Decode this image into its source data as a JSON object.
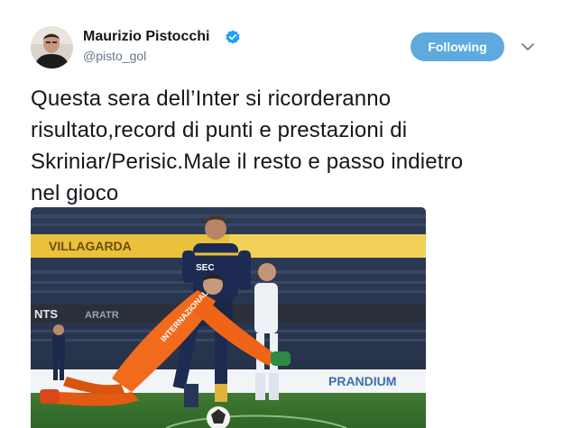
{
  "tweet": {
    "author": {
      "name": "Maurizio Pistocchi",
      "handle": "@pisto_gol",
      "verified": true
    },
    "follow_button": {
      "label": "Following"
    },
    "text_lines": [
      "Questa sera dell’Inter si ricorderanno",
      "risultato,record di punti e prestazioni di",
      "Skriniar/Perisic.Male il resto e passo indietro",
      "nel gioco"
    ],
    "media": {
      "banner_ads": [
        "VILLAGARDA",
        "SEC",
        "NTS",
        "ARATR",
        "PRANDIUM"
      ],
      "goalkeeper_shirt": "INTERNAZIONALE"
    }
  },
  "colors": {
    "follow_button_bg": "#5ea9dd",
    "verified_badge": "#1da1f2",
    "handle_text": "#657786",
    "keeper_orange": "#f26a1b"
  },
  "icons": [
    "verified-badge-icon",
    "chevron-down-icon"
  ]
}
